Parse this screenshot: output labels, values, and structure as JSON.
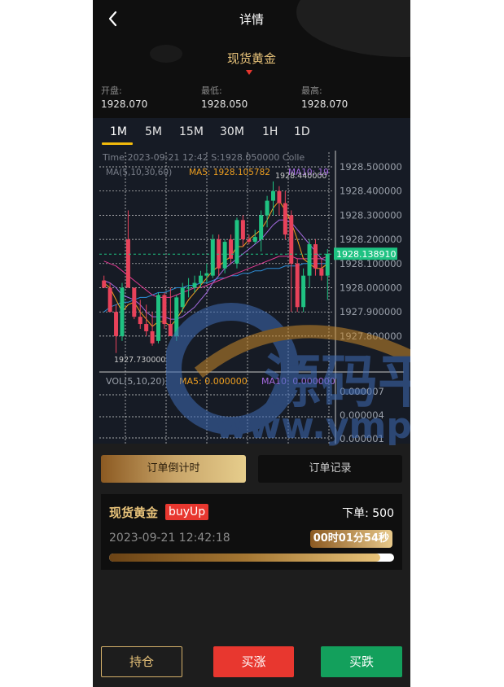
{
  "header": {
    "title": "详情",
    "asset_name": "现货黄金"
  },
  "stats": [
    {
      "label": "开盘:",
      "value": "1928.070"
    },
    {
      "label": "最低:",
      "value": "1928.050"
    },
    {
      "label": "最高:",
      "value": "1928.070"
    }
  ],
  "timeframes": [
    "1M",
    "5M",
    "15M",
    "30M",
    "1H",
    "1D"
  ],
  "active_timeframe": "1M",
  "chart_info": {
    "time_line": "Time:2023-09-21 12:42   S:1928.050000   Colle",
    "ma_label": "MA(5,10,30,60)",
    "ma5_label": "MA5: 1928.105782",
    "ma10_label": "MA10: 19",
    "high_marker": "1928.440000",
    "low_marker": "1927.730000",
    "vol_label": "VOL(5,10,20)",
    "vol_ma5_label": "MA5: 0.000000",
    "vol_ma10_label": "MA10: 0.000000"
  },
  "chart_data": {
    "type": "candlestick",
    "price_axis_labels": [
      "1928.500000",
      "1928.400000",
      "1928.300000",
      "1928.200000",
      "1928.100000",
      "1928.000000",
      "1927.900000",
      "1927.800000"
    ],
    "price_axis_values": [
      1928.5,
      1928.4,
      1928.3,
      1928.2,
      1928.1,
      1928.0,
      1927.9,
      1927.8
    ],
    "current_price": "1928.138910",
    "current_price_value": 1928.13891,
    "volume_axis_labels": [
      "0.000007",
      "0.000004",
      "0.000001"
    ],
    "volume_axis_values": [
      7e-06,
      4e-06,
      1e-06
    ],
    "ylim": [
      1927.75,
      1928.55
    ],
    "candles": [
      {
        "o": 1928.03,
        "h": 1928.05,
        "l": 1928.0,
        "c": 1928.0
      },
      {
        "o": 1928.0,
        "h": 1928.02,
        "l": 1927.9,
        "c": 1927.9
      },
      {
        "o": 1927.9,
        "h": 1927.93,
        "l": 1927.73,
        "c": 1927.8
      },
      {
        "o": 1927.8,
        "h": 1928.02,
        "l": 1927.78,
        "c": 1928.0
      },
      {
        "o": 1928.2,
        "h": 1928.32,
        "l": 1928.0,
        "c": 1928.0
      },
      {
        "o": 1928.0,
        "h": 1928.0,
        "l": 1927.87,
        "c": 1927.88
      },
      {
        "o": 1927.88,
        "h": 1927.95,
        "l": 1927.83,
        "c": 1927.85
      },
      {
        "o": 1927.85,
        "h": 1927.93,
        "l": 1927.8,
        "c": 1927.82
      },
      {
        "o": 1927.82,
        "h": 1927.9,
        "l": 1927.76,
        "c": 1927.77
      },
      {
        "o": 1927.78,
        "h": 1927.98,
        "l": 1927.77,
        "c": 1927.97
      },
      {
        "o": 1927.97,
        "h": 1927.98,
        "l": 1927.83,
        "c": 1927.85
      },
      {
        "o": 1927.85,
        "h": 1928.0,
        "l": 1927.8,
        "c": 1927.8
      },
      {
        "o": 1927.8,
        "h": 1927.97,
        "l": 1927.78,
        "c": 1927.96
      },
      {
        "o": 1927.92,
        "h": 1928.02,
        "l": 1927.9,
        "c": 1928.0
      },
      {
        "o": 1928.0,
        "h": 1928.04,
        "l": 1927.96,
        "c": 1928.0
      },
      {
        "o": 1928.0,
        "h": 1928.05,
        "l": 1927.98,
        "c": 1928.02
      },
      {
        "o": 1928.02,
        "h": 1928.07,
        "l": 1928.0,
        "c": 1928.05
      },
      {
        "o": 1928.05,
        "h": 1928.1,
        "l": 1928.02,
        "c": 1928.06
      },
      {
        "o": 1928.05,
        "h": 1928.22,
        "l": 1928.04,
        "c": 1928.2
      },
      {
        "o": 1928.2,
        "h": 1928.22,
        "l": 1928.05,
        "c": 1928.08
      },
      {
        "o": 1928.08,
        "h": 1928.2,
        "l": 1928.06,
        "c": 1928.19
      },
      {
        "o": 1928.2,
        "h": 1928.22,
        "l": 1928.1,
        "c": 1928.12
      },
      {
        "o": 1928.1,
        "h": 1928.29,
        "l": 1928.08,
        "c": 1928.28
      },
      {
        "o": 1928.28,
        "h": 1928.3,
        "l": 1928.17,
        "c": 1928.2
      },
      {
        "o": 1928.2,
        "h": 1928.22,
        "l": 1928.18,
        "c": 1928.19
      },
      {
        "o": 1928.19,
        "h": 1928.24,
        "l": 1928.18,
        "c": 1928.21
      },
      {
        "o": 1928.2,
        "h": 1928.32,
        "l": 1928.15,
        "c": 1928.3
      },
      {
        "o": 1928.3,
        "h": 1928.38,
        "l": 1928.25,
        "c": 1928.36
      },
      {
        "o": 1928.36,
        "h": 1928.44,
        "l": 1928.3,
        "c": 1928.4
      },
      {
        "o": 1928.4,
        "h": 1928.42,
        "l": 1928.3,
        "c": 1928.35
      },
      {
        "o": 1928.35,
        "h": 1928.4,
        "l": 1928.2,
        "c": 1928.22
      },
      {
        "o": 1928.3,
        "h": 1928.32,
        "l": 1927.9,
        "c": 1928.1
      },
      {
        "o": 1928.1,
        "h": 1928.12,
        "l": 1927.9,
        "c": 1927.92
      },
      {
        "o": 1927.92,
        "h": 1928.08,
        "l": 1927.9,
        "c": 1928.05
      },
      {
        "o": 1928.05,
        "h": 1928.2,
        "l": 1928.0,
        "c": 1928.18
      },
      {
        "o": 1928.18,
        "h": 1928.2,
        "l": 1928.05,
        "c": 1928.08
      },
      {
        "o": 1928.08,
        "h": 1928.12,
        "l": 1928.03,
        "c": 1928.05
      },
      {
        "o": 1928.05,
        "h": 1928.16,
        "l": 1927.95,
        "c": 1928.14
      }
    ],
    "ma5": [
      1928.02,
      1928.0,
      1927.95,
      1927.9,
      1927.93,
      1927.94,
      1927.9,
      1927.87,
      1927.84,
      1927.86,
      1927.86,
      1927.84,
      1927.87,
      1927.91,
      1927.95,
      1927.98,
      1928.01,
      1928.04,
      1928.07,
      1928.09,
      1928.11,
      1928.13,
      1928.17,
      1928.17,
      1928.2,
      1928.22,
      1928.24,
      1928.28,
      1928.33,
      1928.36,
      1928.32,
      1928.27,
      1928.2,
      1928.12,
      1928.1,
      1928.08,
      1928.08,
      1928.1
    ],
    "ma10": [
      1928.03,
      1928.02,
      1928.0,
      1927.97,
      1927.96,
      1927.95,
      1927.93,
      1927.9,
      1927.88,
      1927.88,
      1927.88,
      1927.87,
      1927.87,
      1927.88,
      1927.9,
      1927.92,
      1927.95,
      1927.98,
      1928.02,
      1928.05,
      1928.08,
      1928.1,
      1928.12,
      1928.14,
      1928.16,
      1928.18,
      1928.2,
      1928.23,
      1928.26,
      1928.28,
      1928.28,
      1928.27,
      1928.24,
      1928.21,
      1928.18,
      1928.15,
      1928.12,
      1928.11
    ],
    "ma30": [
      1928.11,
      1928.1,
      1928.09,
      1928.07,
      1928.05,
      1928.03,
      1928.01,
      1927.99,
      1927.97,
      1927.96,
      1927.96,
      1927.96,
      1927.97,
      1927.98,
      1927.99,
      1928.0,
      1928.0,
      1928.01,
      1928.02,
      1928.03,
      1928.04,
      1928.05,
      1928.06,
      1928.07,
      1928.08,
      1928.09,
      1928.1,
      1928.11,
      1928.12,
      1928.13,
      1928.13,
      1928.13,
      1928.12,
      1928.12,
      1928.12,
      1928.12,
      1928.12,
      1928.13
    ],
    "ma60": [
      1927.9,
      1927.92,
      1927.93,
      1927.94,
      1927.94,
      1927.95,
      1927.96,
      1927.96,
      1927.97,
      1927.98,
      1927.98,
      1927.99,
      1928.0,
      1928.0,
      1928.01,
      1928.01,
      1928.02,
      1928.02,
      1928.03,
      1928.04,
      1928.04,
      1928.05,
      1928.05,
      1928.06,
      1928.06,
      1928.07,
      1928.07,
      1928.08,
      1928.08,
      1928.08,
      1928.09,
      1928.09,
      1928.09,
      1928.1,
      1928.1,
      1928.1,
      1928.1,
      1928.1
    ]
  },
  "order_tabs": {
    "countdown": "订单倒计时",
    "records": "订单记录"
  },
  "order_card": {
    "asset": "现货黄金",
    "direction": "buyUp",
    "amount_label": "下单:",
    "amount": "500",
    "time": "2023-09-21 12:42:18",
    "countdown": "00时01分54秒",
    "progress": 0.95
  },
  "bottom_buttons": {
    "hold": "持仓",
    "buy_up": "买涨",
    "buy_down": "买跌"
  },
  "watermark": {
    "text1": "源码平台",
    "text2": "www.ympt.cc"
  },
  "colors": {
    "up": "#e8425a",
    "down": "#1fc282",
    "gold": "#e8c37a",
    "red_button": "#e8372f",
    "green_button": "#13a05c"
  }
}
